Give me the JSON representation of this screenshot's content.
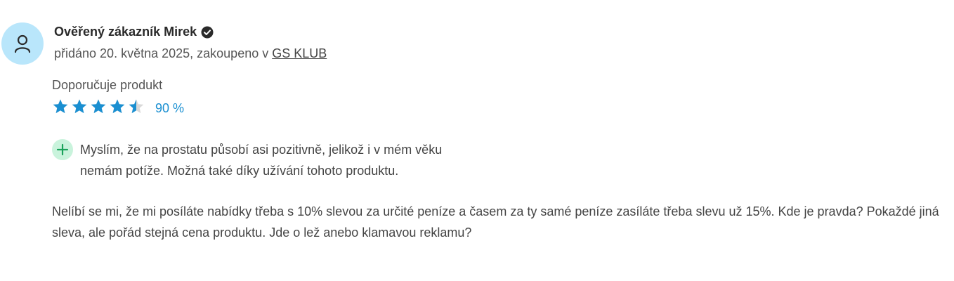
{
  "review": {
    "author": "Ověřený zákazník Mirek",
    "meta_prefix": "přidáno 20. května 2025, zakoupeno v ",
    "store_link": "GS KLUB",
    "recommendation": "Doporučuje produkt",
    "rating": {
      "percent_label": "90 %",
      "value": 0.9,
      "stars_total": 5
    },
    "pro": "Myslím, že na prostatu působí asi pozitivně, jelikož i v mém věku nemám potíže. Možná také díky užívání tohoto produktu.",
    "text": "Nelíbí se mi, že mi posíláte nabídky třeba s 10% slevou za určité peníze a časem za ty samé peníze zasíláte třeba slevu už 15%. Kde je pravda? Pokaždé jiná sleva, ale pořád stejná cena produktu. Jde o lež anebo klamavou reklamu?"
  },
  "icons": {
    "avatar": "user-icon",
    "verified": "check-badge-icon",
    "star": "star-icon",
    "pro": "plus-icon"
  },
  "colors": {
    "avatar_bg": "#b9e6fb",
    "star_filled": "#1a8fd1",
    "star_empty": "#d9d9d9",
    "plus_bg": "#c9f3dc",
    "plus_fg": "#1aa25a"
  }
}
